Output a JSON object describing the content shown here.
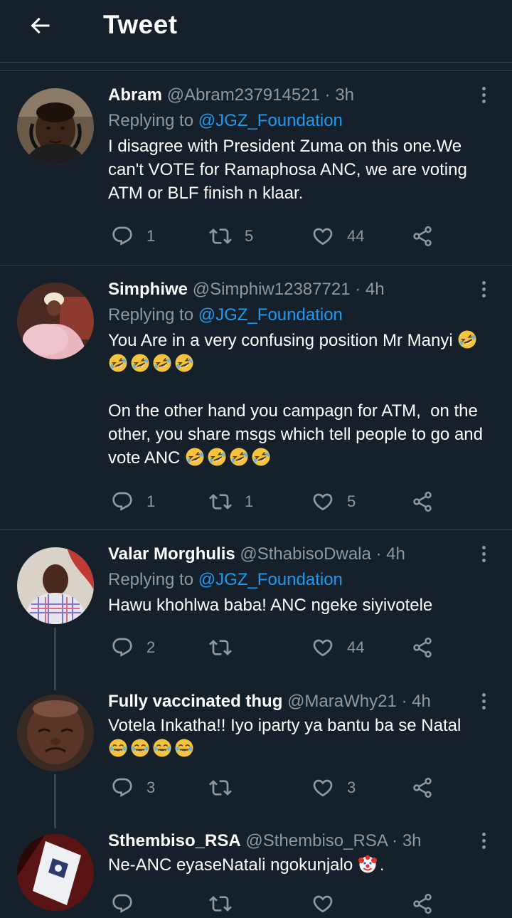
{
  "header": {
    "title": "Tweet"
  },
  "tweets": [
    {
      "name": "Abram",
      "handle": "@Abram237914521",
      "time": "3h",
      "replying_prefix": "Replying to ",
      "replying_to": "@JGZ_Foundation",
      "text": "I disagree with President Zuma on this one.We can't VOTE for Ramaphosa ANC, we are voting ATM or BLF finish n klaar.",
      "replies": "1",
      "retweets": "5",
      "likes": "44"
    },
    {
      "name": "Simphiwe",
      "handle": "@Simphiw12387721",
      "time": "4h",
      "replying_prefix": "Replying to ",
      "replying_to": "@JGZ_Foundation",
      "text_line1": "You Are in a very confusing position Mr Manyi",
      "text_para2": "On the other hand you campagn for ATM,  on the other, you share msgs which tell people to go and vote ANC",
      "replies": "1",
      "retweets": "1",
      "likes": "5"
    },
    {
      "name": "Valar Morghulis",
      "handle": "@SthabisoDwala",
      "time": "4h",
      "replying_prefix": "Replying to ",
      "replying_to": "@JGZ_Foundation",
      "text": "Hawu khohlwa baba! ANC ngeke siyivotele",
      "replies": "2",
      "retweets": "",
      "likes": "44"
    },
    {
      "name": "Fully vaccinated thug",
      "handle": "@MaraWhy21",
      "time": "4h",
      "text": "Votela Inkatha!! Iyo iparty ya bantu ba se Natal",
      "replies": "3",
      "retweets": "",
      "likes": "3"
    },
    {
      "name": "Sthembiso_RSA",
      "handle": "@Sthembiso_RSA",
      "time": "3h",
      "text": "Ne-ANC eyaseNatali ngokunjalo",
      "replies": "",
      "retweets": "",
      "likes": ""
    }
  ],
  "separator": " · ",
  "icons": [
    "back-arrow-icon",
    "more-icon",
    "reply-icon",
    "retweet-icon",
    "like-icon",
    "share-icon",
    "rofl-emoji",
    "joy-emoji",
    "clown-emoji"
  ],
  "colors": {
    "background": "#15202b",
    "accent": "#1d9bf0",
    "muted": "#8b98a5",
    "divider": "#38444d"
  }
}
